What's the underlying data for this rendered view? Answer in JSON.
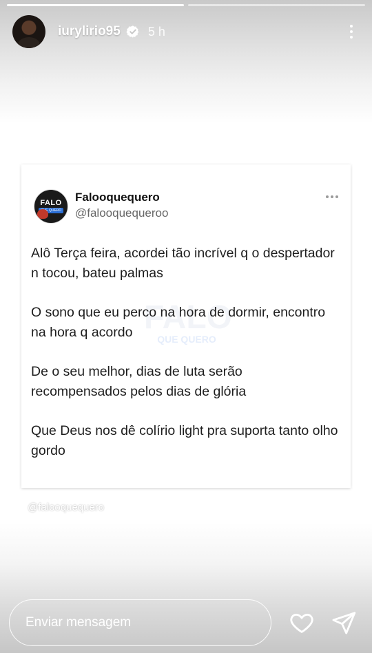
{
  "story": {
    "progress": [
      1.0,
      0.0
    ],
    "username": "iurylirio95",
    "time_ago": "5 h",
    "credit": "@falooquequero",
    "message_placeholder": "Enviar mensagem"
  },
  "tweet": {
    "display_name": "Falooquequero",
    "handle": "@falooquequeroo",
    "logo_text": "FALO",
    "logo_subtext": "QUE QUERO",
    "watermark_text": "FALO",
    "watermark_subtext": "QUE QUERO",
    "paragraphs": [
      "Alô Terça feira, acordei tão incrível q o despertador n tocou, bateu palmas",
      "O sono que eu perco na hora de dormir, encontro na hora q acordo",
      "De o seu melhor, dias de luta serão recompensados pelos dias de glória",
      "Que Deus nos dê colírio light pra suporta tanto olho gordo"
    ]
  },
  "icons": {
    "verified": "verified-badge-icon",
    "more": "more-vertical-icon",
    "tweet_more": "more-horizontal-icon",
    "like": "heart-icon",
    "send": "send-icon"
  },
  "colors": {
    "tweet_text": "#1e1e1e",
    "handle": "#666666",
    "verified_fill": "#ffffff"
  }
}
